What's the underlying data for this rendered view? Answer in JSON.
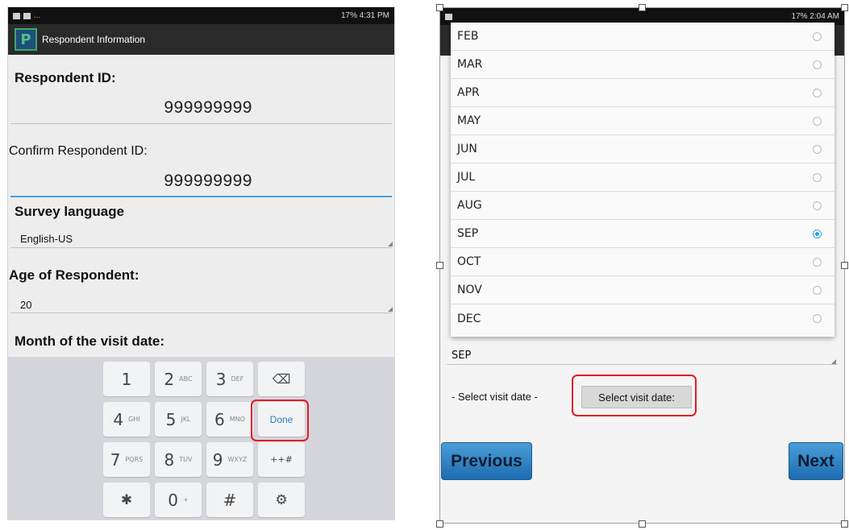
{
  "left": {
    "status": {
      "right_text": "17% 4:31 PM"
    },
    "app_title": "Respondent Information",
    "respondent_id_label": "Respondent ID:",
    "respondent_id_value": "999999999",
    "confirm_id_label": "Confirm Respondent ID:",
    "confirm_id_value": "999999999",
    "survey_language_label": "Survey language",
    "survey_language_value": "English-US",
    "age_label": "Age of Respondent:",
    "age_value": "20",
    "month_label": "Month of the visit date:",
    "keyboard": {
      "keys": [
        {
          "main": "1",
          "sub": ""
        },
        {
          "main": "2",
          "sub": "ABC"
        },
        {
          "main": "3",
          "sub": "DEF"
        },
        {
          "main": "⌫",
          "sub": ""
        },
        {
          "main": "4",
          "sub": "GHI"
        },
        {
          "main": "5",
          "sub": "JKL"
        },
        {
          "main": "6",
          "sub": "MNO"
        },
        {
          "main": "Done",
          "sub": ""
        },
        {
          "main": "7",
          "sub": "PQRS"
        },
        {
          "main": "8",
          "sub": "TUV"
        },
        {
          "main": "9",
          "sub": "WXYZ"
        },
        {
          "main": "++#",
          "sub": ""
        },
        {
          "main": "✱",
          "sub": ""
        },
        {
          "main": "0",
          "sub": "+"
        },
        {
          "main": "#",
          "sub": ""
        },
        {
          "main": "⚙",
          "sub": ""
        }
      ]
    }
  },
  "right": {
    "status": {
      "right_text": "17% 2:04 AM"
    },
    "months": [
      {
        "label": "FEB",
        "selected": false
      },
      {
        "label": "MAR",
        "selected": false
      },
      {
        "label": "APR",
        "selected": false
      },
      {
        "label": "MAY",
        "selected": false
      },
      {
        "label": "JUN",
        "selected": false
      },
      {
        "label": "JUL",
        "selected": false
      },
      {
        "label": "AUG",
        "selected": false
      },
      {
        "label": "SEP",
        "selected": true
      },
      {
        "label": "OCT",
        "selected": false
      },
      {
        "label": "NOV",
        "selected": false
      },
      {
        "label": "DEC",
        "selected": false
      }
    ],
    "month_spinner_value": "SEP",
    "select_visit_label": "- Select visit date -",
    "select_visit_button": "Select visit date:",
    "previous_button": "Previous",
    "next_button": "Next"
  }
}
